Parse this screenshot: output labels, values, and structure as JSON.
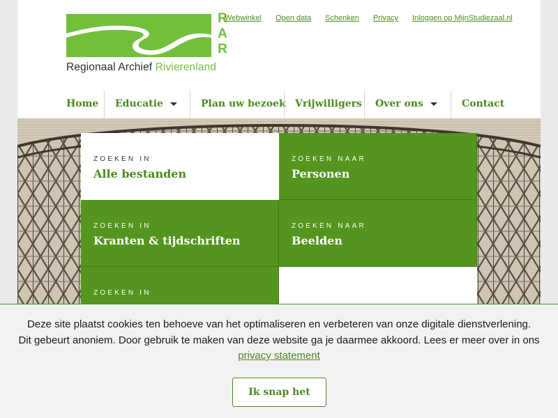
{
  "logo": {
    "rar": [
      "R",
      "A",
      "R"
    ],
    "name_part1": "Regionaal Archief",
    "name_part2": "Rivierenland"
  },
  "toplinks": [
    {
      "label": "Webwinkel"
    },
    {
      "label": "Open data"
    },
    {
      "label": "Schenken"
    },
    {
      "label": "Privacy"
    },
    {
      "label": "Inloggen op MijnStudiezaal.nl"
    }
  ],
  "nav": [
    {
      "label": "Home"
    },
    {
      "label": "Educatie",
      "dropdown": true
    },
    {
      "label": "Plan uw bezoek"
    },
    {
      "label": "Vrijwilligers"
    },
    {
      "label": "Over ons",
      "dropdown": true
    },
    {
      "label": "Contact"
    }
  ],
  "tiles": [
    {
      "kicker": "ZOEKEN IN",
      "title": "Alle bestanden"
    },
    {
      "kicker": "ZOEKEN NAAR",
      "title": "Personen"
    },
    {
      "kicker": "ZOEKEN IN",
      "title": "Kranten & tijdschriften"
    },
    {
      "kicker": "ZOEKEN NAAR",
      "title": "Beelden"
    },
    {
      "kicker": "ZOEKEN IN",
      "title": ""
    }
  ],
  "cookie": {
    "line1": "Deze site plaatst cookies ten behoeve van het optimaliseren en verbeteren van onze digitale dienstverlening.",
    "line2": "Dit gebeurt anoniem. Door gebruik te maken van deze website ga je daarmee akkoord. Lees er meer over in ons",
    "link": "privacy statement",
    "button": "Ik snap het"
  },
  "colors": {
    "brand_green": "#73bf3c",
    "link_green": "#4d8a21",
    "tile_green": "#53951e"
  }
}
